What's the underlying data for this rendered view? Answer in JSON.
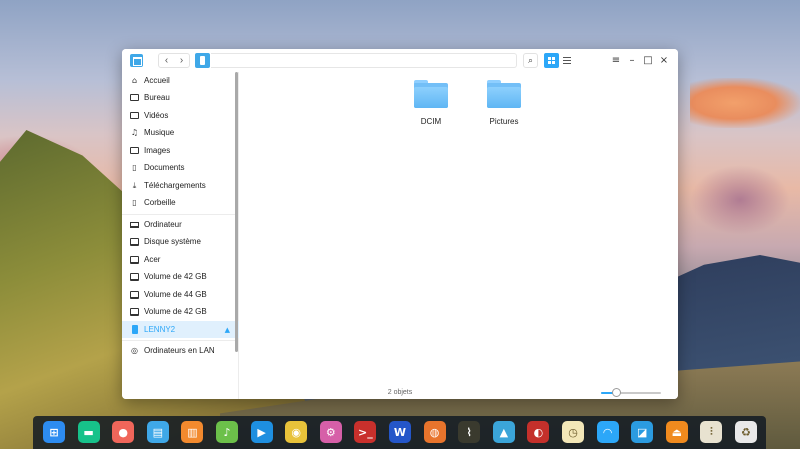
{
  "window": {
    "nav": {
      "back": "‹",
      "forward": "›"
    },
    "search_glyph": "⌕",
    "controls": {
      "menu": "≡",
      "minimize": "–",
      "maximize": "□",
      "close": "×"
    }
  },
  "sidebar": {
    "items": [
      {
        "label": "Accueil",
        "icon": "home-icon"
      },
      {
        "label": "Bureau",
        "icon": "desktop-icon"
      },
      {
        "label": "Vidéos",
        "icon": "video-icon"
      },
      {
        "label": "Musique",
        "icon": "music-icon"
      },
      {
        "label": "Images",
        "icon": "image-icon"
      },
      {
        "label": "Documents",
        "icon": "document-icon"
      },
      {
        "label": "Téléchargements",
        "icon": "download-icon"
      },
      {
        "label": "Corbeille",
        "icon": "trash-icon"
      },
      {
        "label": "Ordinateur",
        "icon": "computer-icon"
      },
      {
        "label": "Disque système",
        "icon": "drive-icon"
      },
      {
        "label": "Acer",
        "icon": "drive-icon"
      },
      {
        "label": "Volume de 42 GB",
        "icon": "drive-icon"
      },
      {
        "label": "Volume de 44 GB",
        "icon": "drive-icon"
      },
      {
        "label": "Volume de 42 GB",
        "icon": "drive-icon"
      },
      {
        "label": "LENNY2",
        "icon": "usb-drive-icon",
        "active": true,
        "eject": "▲"
      },
      {
        "label": "Ordinateurs en LAN",
        "icon": "network-icon"
      }
    ]
  },
  "content": {
    "files": [
      {
        "name": "DCIM",
        "type": "folder"
      },
      {
        "name": "Pictures",
        "type": "folder"
      }
    ],
    "status": "2 objets",
    "zoom_level": 0.25
  },
  "dock": {
    "items": [
      {
        "name": "launcher",
        "glyph": "⊞",
        "color": "#2d8cf0"
      },
      {
        "name": "multitasking",
        "glyph": "▬",
        "color": "#17c28a"
      },
      {
        "name": "screen-recorder",
        "glyph": "●",
        "color": "#f0665a"
      },
      {
        "name": "file-manager",
        "glyph": "▤",
        "color": "#3fa8e8"
      },
      {
        "name": "app-store",
        "glyph": "▥",
        "color": "#f28a2e"
      },
      {
        "name": "music",
        "glyph": "♪",
        "color": "#6cc04a"
      },
      {
        "name": "video-player",
        "glyph": "▶",
        "color": "#1e8fe0"
      },
      {
        "name": "chrome",
        "glyph": "◉",
        "color": "#e8c23a"
      },
      {
        "name": "settings",
        "glyph": "⚙",
        "color": "#d65fa8"
      },
      {
        "name": "terminal",
        "glyph": ">_",
        "color": "#c9302c"
      },
      {
        "name": "wps-writer",
        "glyph": "W",
        "color": "#2456c9"
      },
      {
        "name": "firefox",
        "glyph": "◍",
        "color": "#e8742c"
      },
      {
        "name": "system-monitor",
        "glyph": "⌇",
        "color": "#3a3a2e"
      },
      {
        "name": "image-viewer",
        "glyph": "▲",
        "color": "#3ba5d9"
      },
      {
        "name": "deepin-store",
        "glyph": "◐",
        "color": "#c4302b"
      },
      {
        "name": "clock",
        "glyph": "◷",
        "color": "#f3e7b8"
      },
      {
        "name": "network",
        "glyph": "◠",
        "color": "#2ca7f8"
      },
      {
        "name": "screenshot",
        "glyph": "◪",
        "color": "#2b9be0"
      },
      {
        "name": "disk-eject",
        "glyph": "⏏",
        "color": "#f08a1e"
      },
      {
        "name": "sound-settings",
        "glyph": "⫶",
        "color": "#e8e2d0"
      },
      {
        "name": "trash",
        "glyph": "♻",
        "color": "#e9e9e9"
      }
    ]
  }
}
